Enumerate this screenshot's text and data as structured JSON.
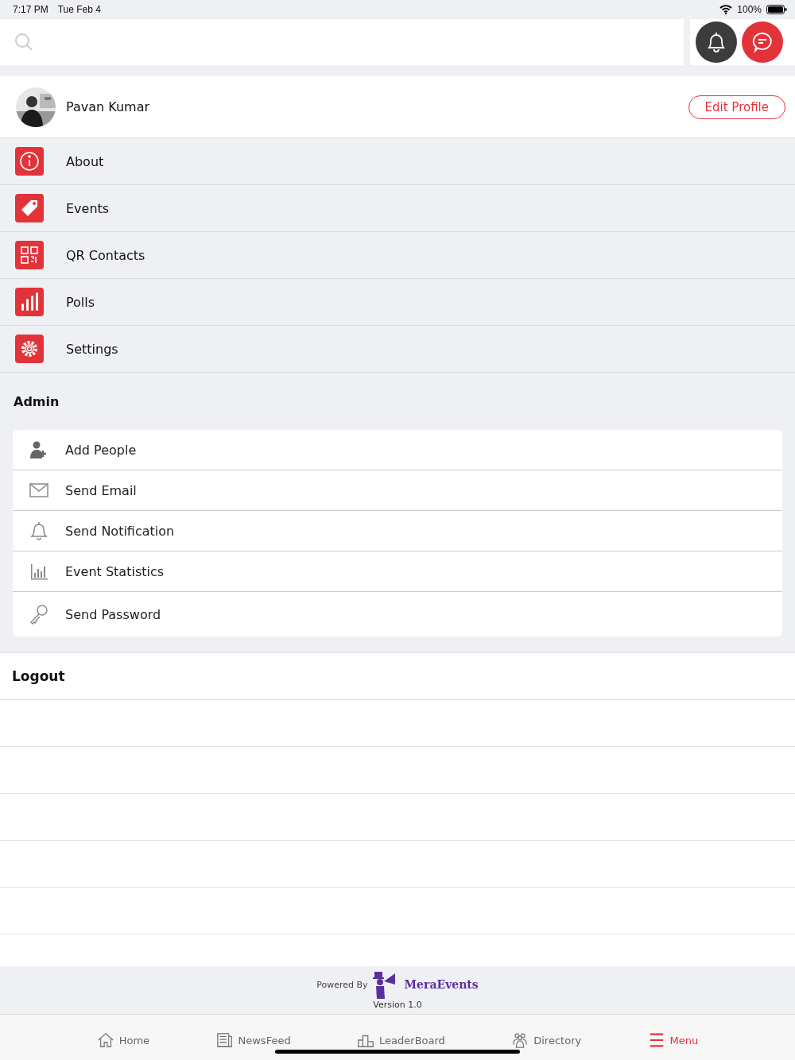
{
  "status_bar": {
    "time": "7:17 PM",
    "date": "Tue Feb 4",
    "battery": "100%"
  },
  "profile": {
    "name": "Pavan Kumar",
    "edit_button": "Edit Profile"
  },
  "menu": [
    {
      "label": "About",
      "kind": "info"
    },
    {
      "label": "Events",
      "kind": "tag"
    },
    {
      "label": "QR Contacts",
      "kind": "qr"
    },
    {
      "label": "Polls",
      "kind": "bars"
    },
    {
      "label": "Settings",
      "kind": "gear"
    }
  ],
  "admin": {
    "title": "Admin",
    "items": [
      {
        "label": "Add People",
        "kind": "add-user"
      },
      {
        "label": "Send Email",
        "kind": "mail"
      },
      {
        "label": "Send Notification",
        "kind": "bell"
      },
      {
        "label": "Event Statistics",
        "kind": "chart"
      },
      {
        "label": "Send Password",
        "kind": "key"
      }
    ]
  },
  "logout": "Logout",
  "footer": {
    "powered_by": "Powered By",
    "brand": "MeraEvents",
    "version": "Version  1.0"
  },
  "tabs": [
    {
      "label": "Home",
      "kind": "home",
      "selected": false
    },
    {
      "label": "NewsFeed",
      "kind": "news",
      "selected": false
    },
    {
      "label": "LeaderBoard",
      "kind": "podium",
      "selected": false
    },
    {
      "label": "Directory",
      "kind": "people",
      "selected": false
    },
    {
      "label": "Menu",
      "kind": "menu",
      "selected": true
    }
  ]
}
